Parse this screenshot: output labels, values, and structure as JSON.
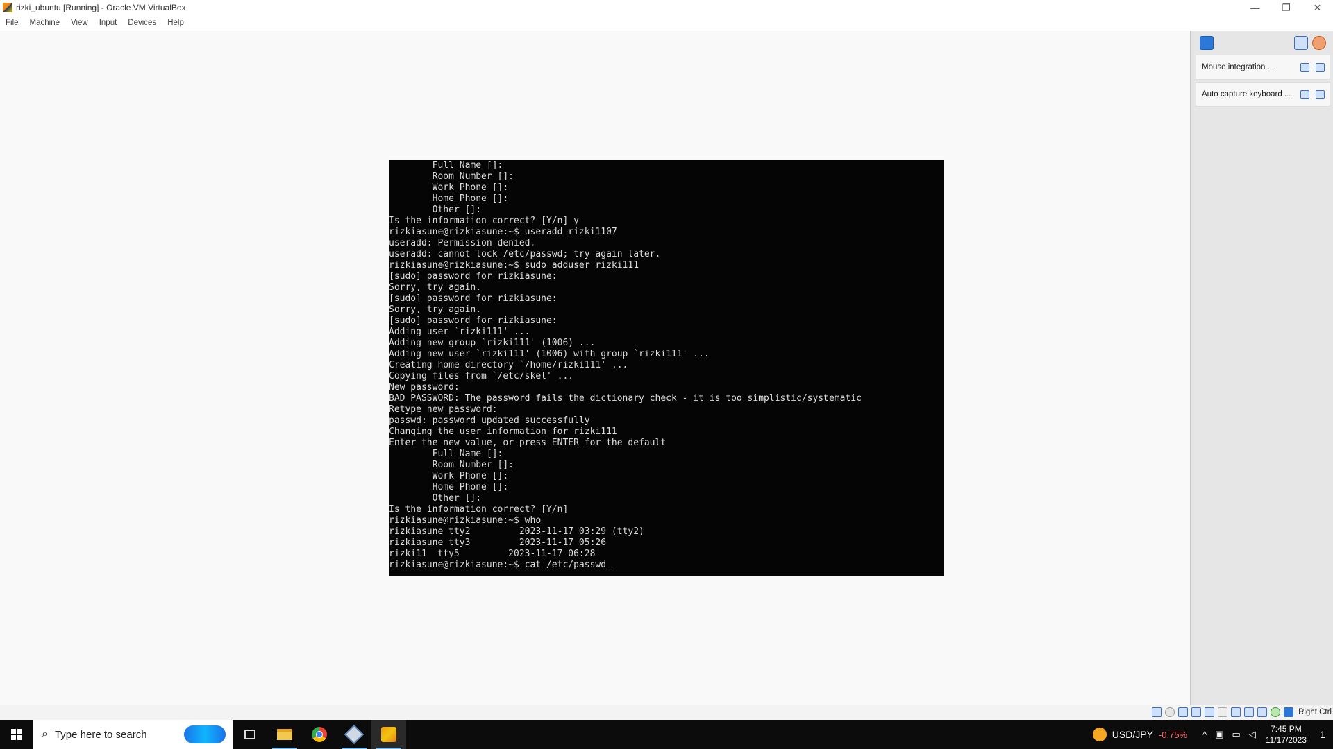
{
  "window": {
    "title": "rizki_ubuntu [Running] - Oracle VM VirtualBox",
    "minimize_glyph": "—",
    "restore_glyph": "❐",
    "close_glyph": "✕"
  },
  "menu": [
    "File",
    "Machine",
    "View",
    "Input",
    "Devices",
    "Help"
  ],
  "terminal": {
    "lines": [
      "        Full Name []:",
      "        Room Number []:",
      "        Work Phone []:",
      "        Home Phone []:",
      "        Other []:",
      "Is the information correct? [Y/n] y",
      "rizkiasune@rizkiasune:~$ useradd rizki1107",
      "useradd: Permission denied.",
      "useradd: cannot lock /etc/passwd; try again later.",
      "rizkiasune@rizkiasune:~$ sudo adduser rizki111",
      "[sudo] password for rizkiasune:",
      "Sorry, try again.",
      "[sudo] password for rizkiasune:",
      "Sorry, try again.",
      "[sudo] password for rizkiasune:",
      "Adding user `rizki111' ...",
      "Adding new group `rizki111' (1006) ...",
      "Adding new user `rizki111' (1006) with group `rizki111' ...",
      "Creating home directory `/home/rizki111' ...",
      "Copying files from `/etc/skel' ...",
      "New password:",
      "BAD PASSWORD: The password fails the dictionary check - it is too simplistic/systematic",
      "Retype new password:",
      "passwd: password updated successfully",
      "Changing the user information for rizki111",
      "Enter the new value, or press ENTER for the default",
      "        Full Name []:",
      "        Room Number []:",
      "        Work Phone []:",
      "        Home Phone []:",
      "        Other []:",
      "Is the information correct? [Y/n]",
      "rizkiasune@rizkiasune:~$ who",
      "rizkiasune tty2         2023-11-17 03:29 (tty2)",
      "rizkiasune tty3         2023-11-17 05:26",
      "rizki11  tty5         2023-11-17 06:28",
      "rizkiasune@rizkiasune:~$ cat /etc/passwd_"
    ]
  },
  "notifications": {
    "items": [
      {
        "text": "Mouse integration ..."
      },
      {
        "text": "Auto capture keyboard ..."
      }
    ]
  },
  "statusbar": {
    "host_key": "Right Ctrl"
  },
  "taskbar": {
    "search_placeholder": "Type here to search",
    "search_glyph": "⌕",
    "stock_name": "USD/JPY",
    "stock_change": "-0.75%",
    "tray_chevron": "^",
    "time": "7:45 PM",
    "date": "11/17/2023",
    "notification_count": "1"
  },
  "colors": {
    "terminal_bg": "#050505",
    "terminal_fg": "#dcdcdc",
    "taskbar_bg": "#0c0c0c",
    "accent": "#76b9ed",
    "stock_down": "#ff6b6b"
  }
}
